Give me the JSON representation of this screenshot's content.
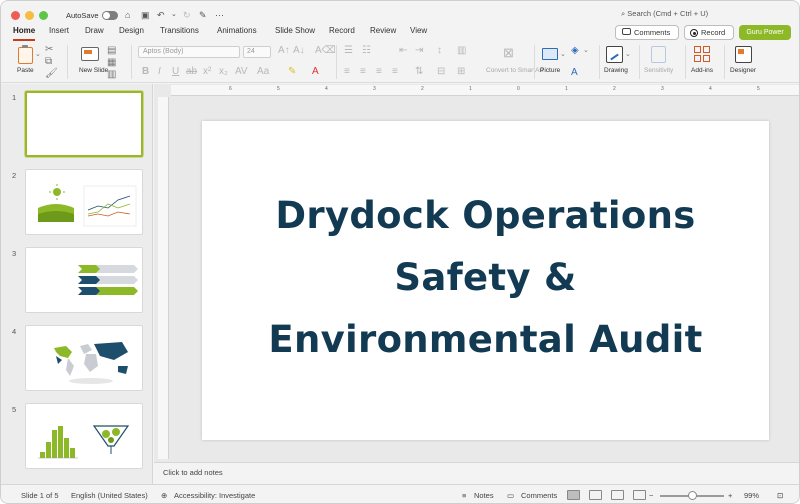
{
  "titlebar": {
    "autosave_label": "AutoSave",
    "search_placeholder": "Search (Cmd + Ctrl + U)"
  },
  "tabs": [
    {
      "label": "Home",
      "active": true
    },
    {
      "label": "Insert"
    },
    {
      "label": "Draw"
    },
    {
      "label": "Design"
    },
    {
      "label": "Transitions"
    },
    {
      "label": "Animations"
    },
    {
      "label": "Slide Show"
    },
    {
      "label": "Record"
    },
    {
      "label": "Review"
    },
    {
      "label": "View"
    }
  ],
  "header_buttons": {
    "comments": "Comments",
    "record": "Record",
    "guru": "Guru Power"
  },
  "ribbon": {
    "paste": "Paste",
    "new_slide": "New Slide",
    "font_name": "Aptos (Body)",
    "font_size": "24",
    "convert_smartart": "Convert to SmartArt",
    "picture": "Picture",
    "drawing": "Drawing",
    "sensitivity": "Sensitivity",
    "addins": "Add-ins",
    "designer": "Designer"
  },
  "thumbnails": [
    {
      "number": "1",
      "selected": true
    },
    {
      "number": "2"
    },
    {
      "number": "3"
    },
    {
      "number": "4"
    },
    {
      "number": "5"
    }
  ],
  "slide": {
    "title_lines": [
      "Drydock Operations",
      "Safety &",
      "Environmental Audit"
    ]
  },
  "ruler_numbers": [
    "6",
    "5",
    "4",
    "3",
    "2",
    "1",
    "0",
    "1",
    "2",
    "3",
    "4",
    "5",
    "6"
  ],
  "notes_placeholder": "Click to add notes",
  "status": {
    "slide_counter": "Slide 1 of 5",
    "language": "English (United States)",
    "accessibility": "Accessibility: Investigate",
    "notes": "Notes",
    "comments": "Comments",
    "zoom": "99%"
  },
  "colors": {
    "accent": "#c43e1c",
    "guru": "#8db828",
    "title": "#123a52",
    "thumb_green": "#8db828",
    "thumb_navy": "#1d4e6b"
  }
}
